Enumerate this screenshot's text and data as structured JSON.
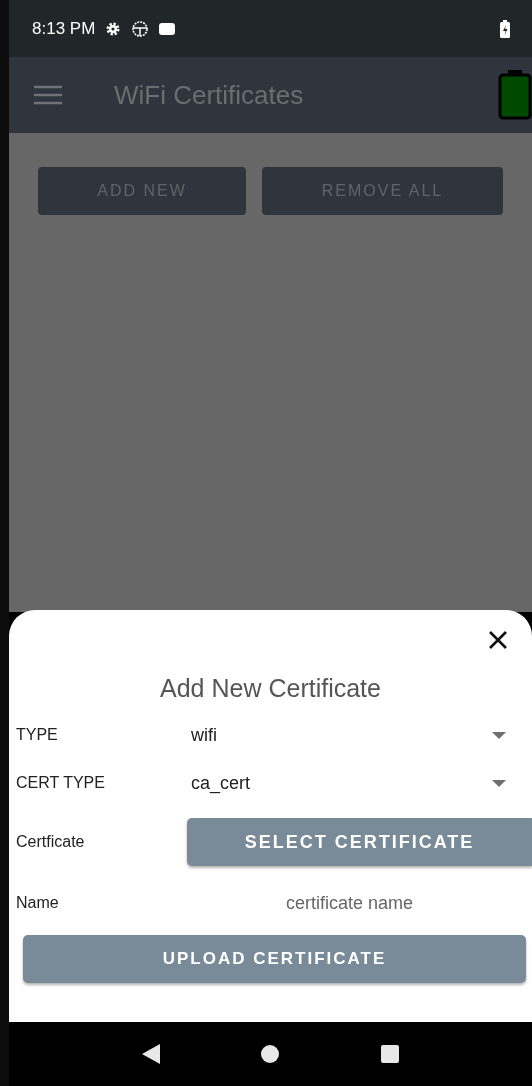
{
  "status_bar": {
    "time": "8:13 PM"
  },
  "app_bar": {
    "title": "WiFi Certificates"
  },
  "actions": [
    "ADD NEW",
    "REMOVE ALL"
  ],
  "sheet": {
    "title": "Add New Certificate",
    "fields": [
      {
        "kind": "dropdown",
        "label": "TYPE",
        "value": "wifi"
      },
      {
        "kind": "dropdown",
        "label": "CERT TYPE",
        "value": "ca_cert"
      },
      {
        "kind": "button",
        "label": "Certficate",
        "button": "SELECT CERTIFICATE"
      },
      {
        "kind": "input",
        "label": "Name",
        "placeholder": "certificate name"
      }
    ],
    "submit": "UPLOAD CERTIFICATE"
  }
}
